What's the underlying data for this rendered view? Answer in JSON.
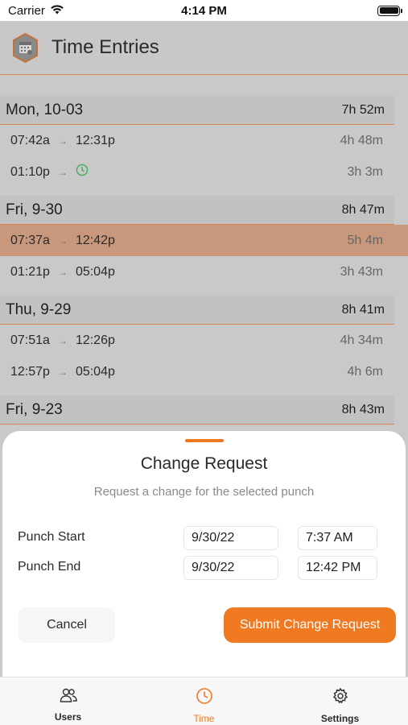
{
  "status_bar": {
    "carrier": "Carrier",
    "time": "4:14 PM"
  },
  "header": {
    "title": "Time Entries",
    "icon": "calendar-gear-logo"
  },
  "days": [
    {
      "label": "Mon, 10-03",
      "total": "7h 52m",
      "entries": [
        {
          "start": "07:42a",
          "end": "12:31p",
          "duration": "4h 48m",
          "open": false
        },
        {
          "start": "01:10p",
          "end": "",
          "duration": "3h 3m",
          "open": true
        }
      ]
    },
    {
      "label": "Fri, 9-30",
      "total": "8h 47m",
      "entries": [
        {
          "start": "07:37a",
          "end": "12:42p",
          "duration": "5h 4m",
          "open": false,
          "selected": true
        },
        {
          "start": "01:21p",
          "end": "05:04p",
          "duration": "3h 43m",
          "open": false
        }
      ]
    },
    {
      "label": "Thu, 9-29",
      "total": "8h 41m",
      "entries": [
        {
          "start": "07:51a",
          "end": "12:26p",
          "duration": "4h 34m",
          "open": false
        },
        {
          "start": "12:57p",
          "end": "05:04p",
          "duration": "4h 6m",
          "open": false
        }
      ]
    },
    {
      "label": "Fri, 9-23",
      "total": "8h 43m",
      "entries": []
    }
  ],
  "arrow_glyph": "→",
  "sheet": {
    "title": "Change Request",
    "subtitle": "Request a change for the selected punch",
    "punch_start_label": "Punch Start",
    "punch_end_label": "Punch End",
    "punch_start_date": "9/30/22",
    "punch_start_time": "7:37 AM",
    "punch_end_date": "9/30/22",
    "punch_end_time": "12:42 PM",
    "cancel_label": "Cancel",
    "submit_label": "Submit Change Request"
  },
  "tabs": [
    {
      "label": "Users",
      "icon": "users-icon",
      "active": false
    },
    {
      "label": "Time",
      "icon": "clock-icon",
      "active": true
    },
    {
      "label": "Settings",
      "icon": "gear-icon",
      "active": false
    }
  ],
  "colors": {
    "accent": "#ef7a22",
    "selected_row": "#c9987c",
    "open_clock": "#3fae5a"
  }
}
